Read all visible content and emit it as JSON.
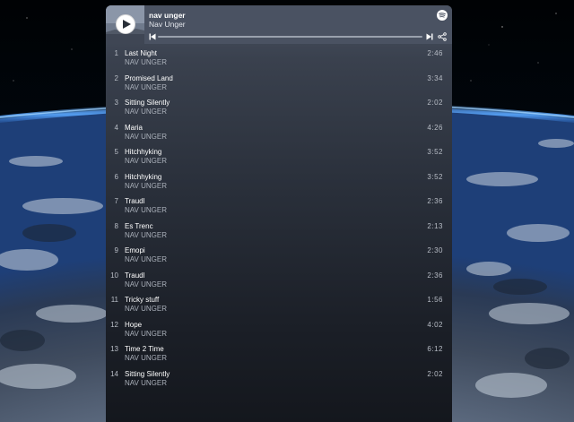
{
  "player": {
    "title": "nav unger",
    "artist": "Nav Unger",
    "progress": 0
  },
  "icons": {
    "play": "play-icon",
    "spotify": "spotify-logo-icon",
    "previous": "skip-previous-icon",
    "next": "skip-next-icon",
    "share": "share-icon"
  },
  "colors": {
    "panel_header": "#4a5262",
    "panel_bottom": "#14171d",
    "text_primary": "#ffffff",
    "text_secondary": "#aab0ba"
  },
  "tracks": [
    {
      "num": "1",
      "name": "Last Night",
      "artist": "NAV UNGER",
      "duration": "2:46"
    },
    {
      "num": "2",
      "name": "Promised Land",
      "artist": "NAV UNGER",
      "duration": "3:34"
    },
    {
      "num": "3",
      "name": "Sitting Silently",
      "artist": "NAV UNGER",
      "duration": "2:02"
    },
    {
      "num": "4",
      "name": "Maria",
      "artist": "NAV UNGER",
      "duration": "4:26"
    },
    {
      "num": "5",
      "name": "Hitchhyking",
      "artist": "NAV UNGER",
      "duration": "3:52"
    },
    {
      "num": "6",
      "name": "Hitchhyking",
      "artist": "NAV UNGER",
      "duration": "3:52"
    },
    {
      "num": "7",
      "name": "Traudl",
      "artist": "NAV UNGER",
      "duration": "2:36"
    },
    {
      "num": "8",
      "name": "Es Trenc",
      "artist": "NAV UNGER",
      "duration": "2:13"
    },
    {
      "num": "9",
      "name": "Emopi",
      "artist": "NAV UNGER",
      "duration": "2:30"
    },
    {
      "num": "10",
      "name": "Traudl",
      "artist": "NAV UNGER",
      "duration": "2:36"
    },
    {
      "num": "11",
      "name": "Tricky stuff",
      "artist": "NAV UNGER",
      "duration": "1:56"
    },
    {
      "num": "12",
      "name": "Hope",
      "artist": "NAV UNGER",
      "duration": "4:02"
    },
    {
      "num": "13",
      "name": "Time 2 Time",
      "artist": "NAV UNGER",
      "duration": "6:12"
    },
    {
      "num": "14",
      "name": "Sitting Silently",
      "artist": "NAV UNGER",
      "duration": "2:02"
    }
  ]
}
